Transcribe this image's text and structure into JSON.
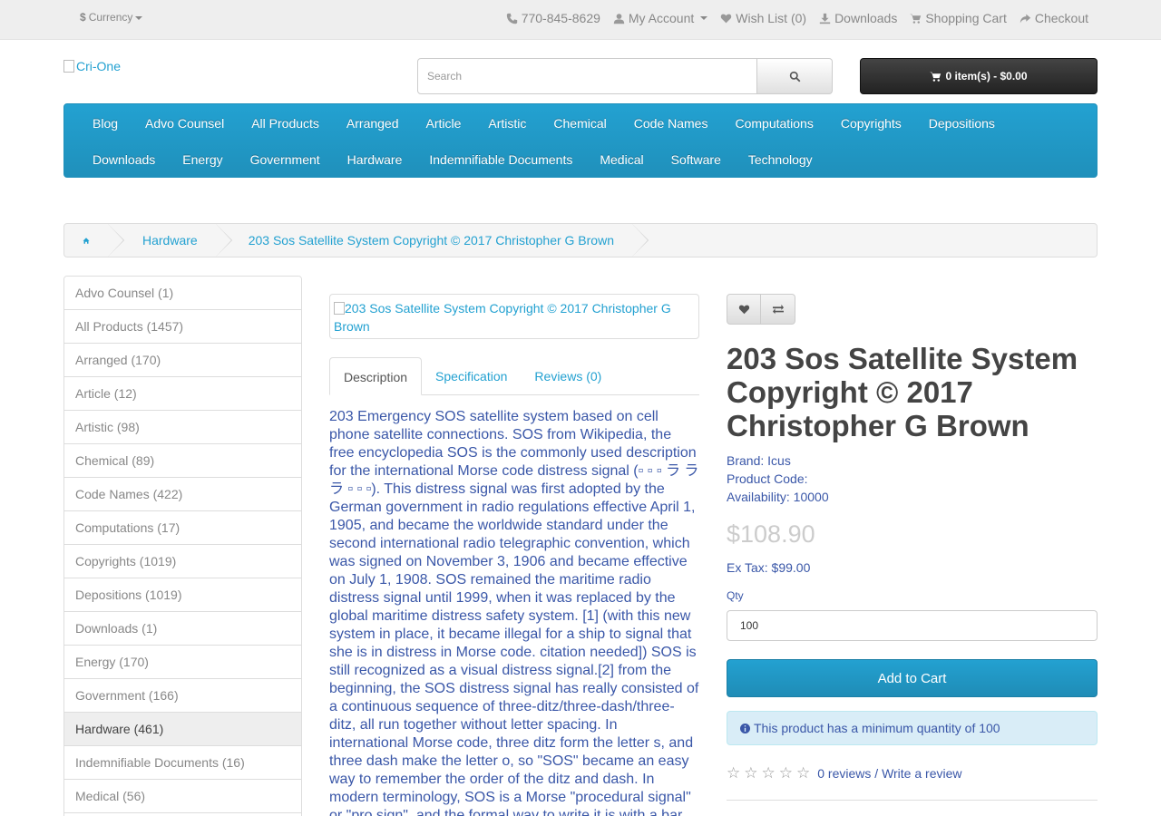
{
  "topbar": {
    "currency_symbol": "$",
    "currency_label": "Currency",
    "phone": "770-845-8629",
    "my_account": "My Account",
    "wishlist": "Wish List (0)",
    "downloads": "Downloads",
    "shopping_cart": "Shopping Cart",
    "checkout": "Checkout"
  },
  "header": {
    "logo_alt": "Cri-One",
    "search_placeholder": "Search",
    "cart_label": "0 item(s) - $0.00"
  },
  "menu": {
    "row1": [
      "Blog",
      "Advo Counsel",
      "All Products",
      "Arranged",
      "Article",
      "Artistic",
      "Chemical",
      "Code Names",
      "Computations",
      "Copyrights",
      "Depositions"
    ],
    "row2": [
      "Downloads",
      "Energy",
      "Government",
      "Hardware",
      "Indemnifiable Documents",
      "Medical",
      "Software",
      "Technology"
    ]
  },
  "breadcrumb": {
    "category": "Hardware",
    "product": "203 Sos Satellite System Copyright © 2017 Christopher G Brown"
  },
  "sidebar": {
    "items": [
      "Advo Counsel (1)",
      "All Products (1457)",
      "Arranged (170)",
      "Article (12)",
      "Artistic (98)",
      "Chemical (89)",
      "Code Names (422)",
      "Computations (17)",
      "Copyrights (1019)",
      "Depositions (1019)",
      "Downloads (1)",
      "Energy (170)",
      "Government (166)",
      "Hardware (461)",
      "Indemnifiable Documents (16)",
      "Medical (56)"
    ],
    "active_index": 13
  },
  "product": {
    "image_alt": "203 Sos Satellite System Copyright © 2017 Christopher G Brown",
    "tabs": [
      "Description",
      "Specification",
      "Reviews (0)"
    ],
    "description": "203 Emergency SOS satellite system based on cell phone satellite connections. SOS from Wikipedia, the free encyclopedia SOS is the commonly used description for the international Morse code distress signal (▫ ▫ ▫ ラ ラ ラ ▫ ▫ ▫). This distress signal was first adopted by the German government in radio regulations effective April 1, 1905, and became the worldwide standard under the second international radio telegraphic convention, which was signed on November 3, 1906 and became effective on July 1, 1908. SOS remained the maritime radio distress signal until 1999, when it was replaced by the global maritime distress safety system. [1] (with this new system in place, it became illegal for a ship to signal that she is in distress in Morse code. citation needed]) SOS is still recognized as a visual distress signal.[2] from the beginning, the SOS distress signal has really consisted of a continuous sequence of three-ditz/three-dash/three-ditz, all run together without letter spacing. In international Morse code, three ditz form the letter s, and three dash make the letter o, so \"SOS\" became an easy way to remember the order of the ditz and dash. In modern terminology, SOS is a Morse \"procedural signal\" or \"pro sign\", and the formal way to write it is with a bar",
    "title": "203 Sos Satellite System Copyright © 2017 Christopher G Brown",
    "brand_label": "Brand:",
    "brand": "Icus",
    "product_code_label": "Product Code:",
    "availability_label": "Availability:",
    "availability": "10000",
    "price": "$108.90",
    "ex_tax": "Ex Tax: $99.00",
    "qty_label": "Qty",
    "qty_value": "100",
    "add_to_cart": "Add to Cart",
    "min_qty_notice": "This product has a minimum quantity of 100",
    "reviews_link": "0 reviews",
    "write_review": "Write a review",
    "rating": 0,
    "rating_max": 5
  },
  "colors": {
    "accent": "#23a1d1",
    "link_dark": "#3a57a8",
    "topbar_bg": "#eeeeee"
  }
}
